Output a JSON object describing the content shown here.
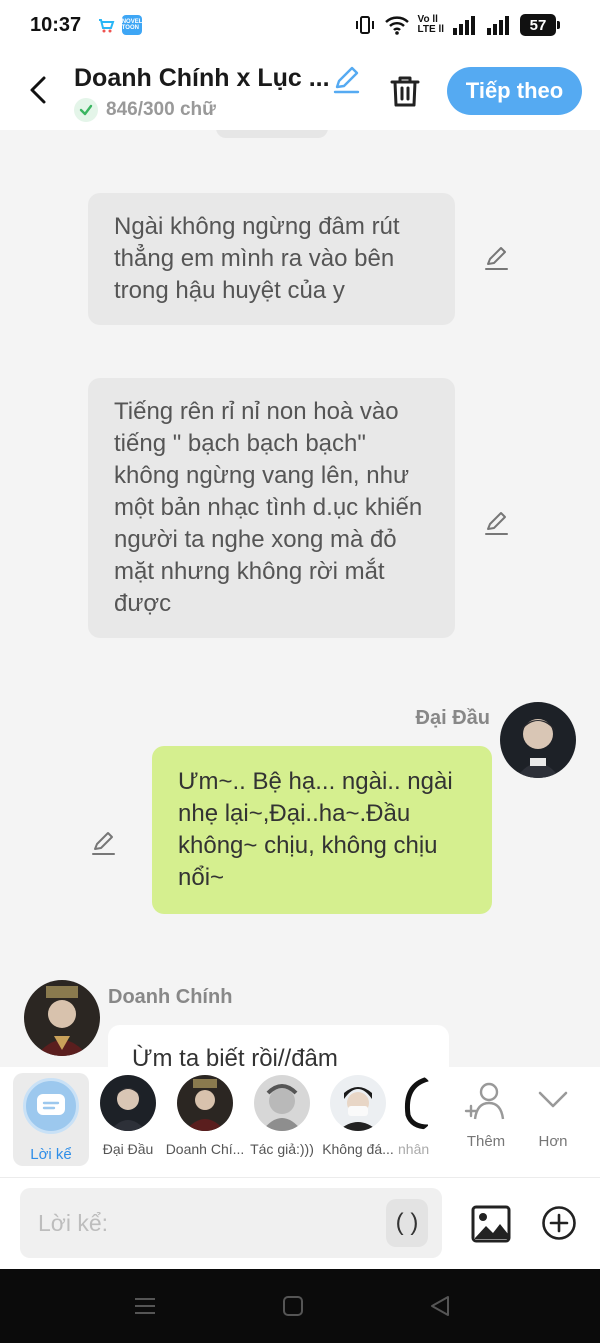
{
  "status_bar": {
    "time": "10:37",
    "network_label_top": "Vo ll",
    "network_label_bottom": "LTE ll",
    "battery": "57",
    "app_icon_1": "shop-icon",
    "app_icon_2": "novel-toon-icon",
    "app_icon_2_text": "NOVEL TOON"
  },
  "header": {
    "title": "Doanh Chính x Lục ...",
    "word_count": "846/300 chữ",
    "next_label": "Tiếp theo",
    "accent_color": "#55aaf2"
  },
  "messages": [
    {
      "type": "narration",
      "text": "Ngài không ngừng đâm rút thẳng em mình ra vào bên trong hậu huyệt của y"
    },
    {
      "type": "narration",
      "text": "Tiếng rên rỉ nỉ non hoà vào tiếng \" bạch bạch bạch\" không ngừng vang lên, như một bản nhạc tình d.ục khiến người ta nghe xong mà đỏ mặt nhưng không rời mắt được"
    },
    {
      "type": "right",
      "sender": "Đại Đầu",
      "text": "Ưm~.. Bệ hạ... ngài.. ngài nhẹ lại~,Đại..ha~.Đầu không~ chịu, không chịu nổi~",
      "bubble_color": "#d5ef8f"
    },
    {
      "type": "left",
      "sender": "Doanh Chính",
      "text": "Ừm ta biết rồi//đâm"
    }
  ],
  "characters": {
    "narrator_label": "Lời kể",
    "items": [
      {
        "label": "Đại Đầu"
      },
      {
        "label": "Doanh Chí..."
      },
      {
        "label": "Tác giả:)))"
      },
      {
        "label": "Không đá..."
      },
      {
        "label": "nhân"
      }
    ],
    "add_label": "Thêm",
    "more_label": "Hơn"
  },
  "input": {
    "placeholder": "Lời kể:",
    "paren_label": "( )"
  }
}
